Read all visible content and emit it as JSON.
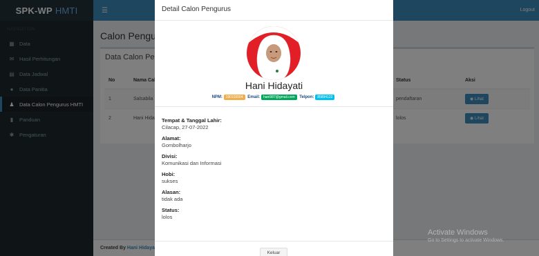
{
  "app": {
    "brand_main": "SPK-WP",
    "brand_sub": "HMTI",
    "logout": "Logout"
  },
  "sidebar": {
    "header": "NAVIGATION",
    "items": [
      {
        "icon": "dashboard-icon",
        "label": "Data"
      },
      {
        "icon": "envelope-icon",
        "label": "Hasil Perhitungan"
      },
      {
        "icon": "calendar-icon",
        "label": "Data Jadwal"
      },
      {
        "icon": "user-icon",
        "label": "Data Panitia"
      },
      {
        "icon": "users-icon",
        "label": "Data Calon Pengurus HMTI",
        "active": true
      },
      {
        "icon": "book-icon",
        "label": "Panduan"
      },
      {
        "icon": "gear-icon",
        "label": "Pengaturan"
      }
    ]
  },
  "main": {
    "title": "Calon Pengurus",
    "box_title": "Data Calon Pengurus",
    "columns": [
      "No",
      "Nama Calon",
      "Status",
      "Aksi"
    ],
    "rows": [
      {
        "no": "1",
        "nama": "Salsabila",
        "status": "pendaftaran",
        "aksi": "Lihat"
      },
      {
        "no": "2",
        "nama": "Hani Hidayati",
        "status": "lolos",
        "aksi": "Lihat"
      }
    ],
    "footer_prefix": "Created By",
    "footer_name": "Hani Hidayati"
  },
  "modal": {
    "title": "Detail Calon Pengurus",
    "name": "Hani Hidayati",
    "npm_label": "NPM:",
    "npm": "190102004",
    "email_label": "Email:",
    "email": "hani987@gmail.com",
    "telpon_label": "Telpon:",
    "telpon": "85894122",
    "fields": [
      {
        "label": "Tempat & Tanggal Lahir:",
        "value": "Cilacap, 27-07-2022"
      },
      {
        "label": "Alamat:",
        "value": "Gombolharjo"
      },
      {
        "label": "Divisi:",
        "value": "Komunikasi dan Informasi"
      },
      {
        "label": "Hobi:",
        "value": "sukses"
      },
      {
        "label": "Alasan:",
        "value": "tidak ada"
      },
      {
        "label": "Status:",
        "value": "lolos"
      }
    ],
    "close_button": "Keluar"
  },
  "watermark": {
    "line1": "Activate Windows",
    "line2": "Go to Settings to activate Windows."
  },
  "colors": {
    "primary": "#3c8dbc",
    "sidebar": "#1f2a2f",
    "npm_badge": "#f0ad4e",
    "email_badge": "#00a65a",
    "tel_badge": "#00c0ef"
  }
}
